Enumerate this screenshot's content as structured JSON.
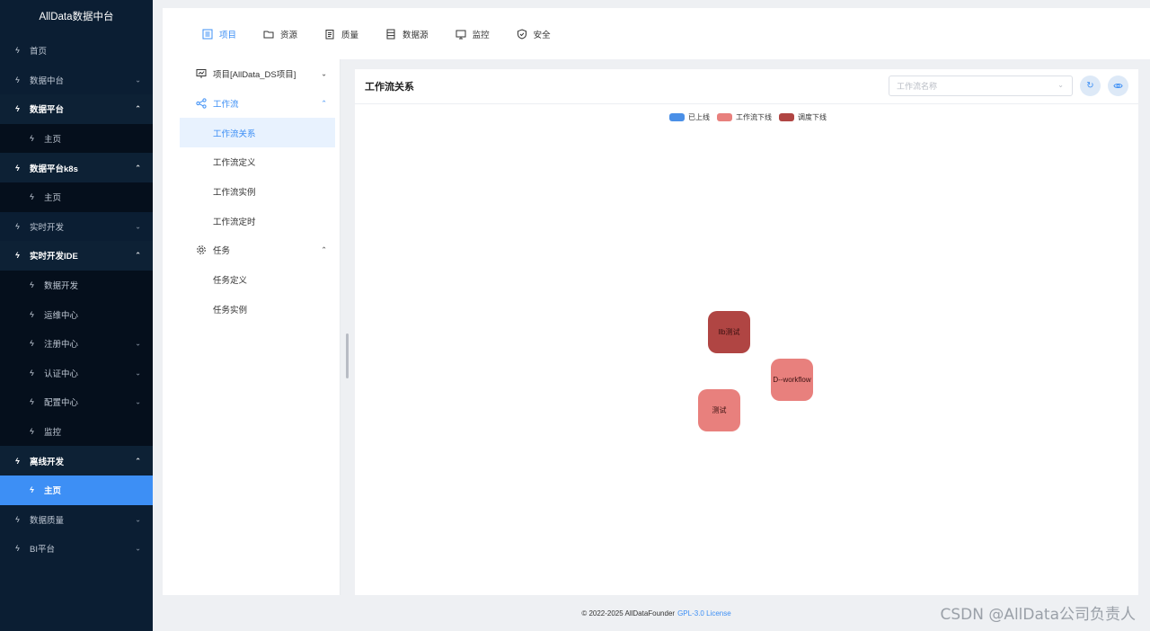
{
  "app": {
    "title": "AllData数据中台"
  },
  "sidebar": {
    "items": [
      {
        "label": "首页"
      },
      {
        "label": "数据中台"
      },
      {
        "label": "数据平台"
      },
      {
        "label": "主页"
      },
      {
        "label": "数据平台k8s"
      },
      {
        "label": "主页"
      },
      {
        "label": "实时开发"
      },
      {
        "label": "实时开发IDE"
      },
      {
        "label": "数据开发"
      },
      {
        "label": "运维中心"
      },
      {
        "label": "注册中心"
      },
      {
        "label": "认证中心"
      },
      {
        "label": "配置中心"
      },
      {
        "label": "监控"
      },
      {
        "label": "离线开发"
      },
      {
        "label": "主页"
      },
      {
        "label": "数据质量"
      },
      {
        "label": "BI平台"
      }
    ]
  },
  "topnav": {
    "tabs": [
      {
        "label": "项目",
        "icon": "project-icon"
      },
      {
        "label": "资源",
        "icon": "folder-icon"
      },
      {
        "label": "质量",
        "icon": "clipboard-icon"
      },
      {
        "label": "数据源",
        "icon": "database-icon"
      },
      {
        "label": "监控",
        "icon": "monitor-icon"
      },
      {
        "label": "安全",
        "icon": "shield-icon"
      }
    ]
  },
  "subnav": {
    "project": "项目[AllData_DS项目]",
    "workflow_group": "工作流",
    "workflow_items": [
      "工作流关系",
      "工作流定义",
      "工作流实例",
      "工作流定时"
    ],
    "task_group": "任务",
    "task_items": [
      "任务定义",
      "任务实例"
    ]
  },
  "panel": {
    "title": "工作流关系",
    "select_placeholder": "工作流名称",
    "refresh_icon": "refresh-icon",
    "view_icon": "eye-icon"
  },
  "legend": [
    {
      "label": "已上线",
      "color": "#4a8fe7"
    },
    {
      "label": "工作流下线",
      "color": "#e8807d"
    },
    {
      "label": "调度下线",
      "color": "#b04543"
    }
  ],
  "graph": {
    "nodes": [
      {
        "label": "llb测试",
        "status": "调度下线"
      },
      {
        "label": "D--workflow",
        "status": "工作流下线"
      },
      {
        "label": "测试",
        "status": "工作流下线"
      }
    ]
  },
  "footer": {
    "copyright": "© 2022-2025 AllDataFounder",
    "license": "GPL-3.0 License"
  },
  "watermark": "CSDN @AllData公司负责人"
}
